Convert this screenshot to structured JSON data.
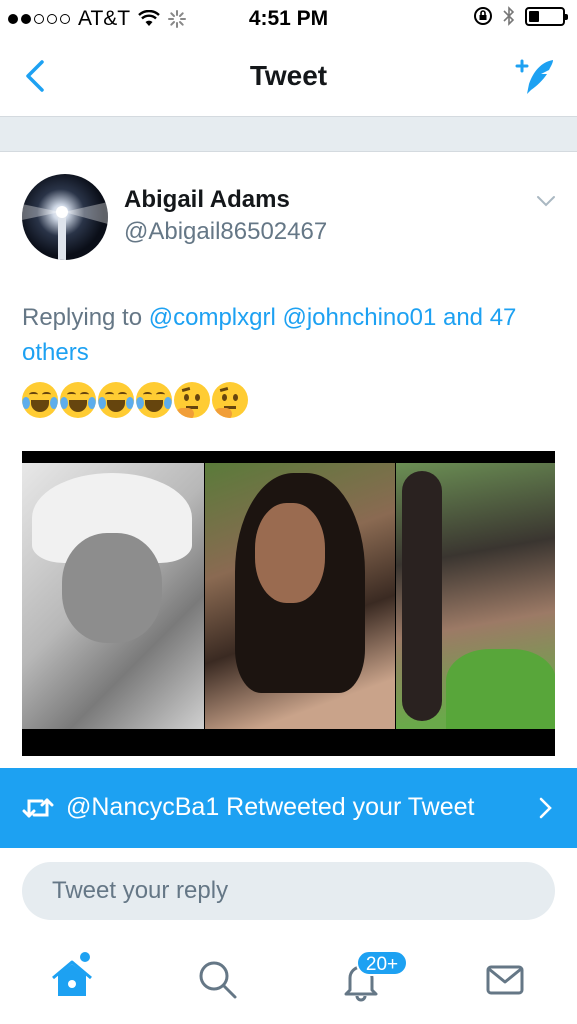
{
  "status_bar": {
    "carrier": "AT&T",
    "time": "4:51 PM",
    "signal_bars_filled": 2,
    "signal_bars_total": 5,
    "battery_level": 0.3
  },
  "nav": {
    "title": "Tweet",
    "back_icon": "chevron-left-icon",
    "compose_icon": "compose-tweet-icon"
  },
  "tweet": {
    "author_name": "Abigail Adams",
    "author_handle": "@Abigail86502467",
    "replying_prefix": "Replying to",
    "replying_mentions": [
      "@complxgrl",
      "@johnchino01"
    ],
    "replying_and": "and",
    "replying_others": "47 others",
    "emojis": [
      "face-with-tears-of-joy",
      "face-with-tears-of-joy",
      "face-with-tears-of-joy",
      "face-with-tears-of-joy",
      "thinking-face",
      "thinking-face"
    ]
  },
  "retweet_banner": {
    "text": "@NancycBa1 Retweeted your Tweet"
  },
  "reply": {
    "placeholder": "Tweet your reply"
  },
  "tabs": {
    "notifications_badge": "20+"
  },
  "colors": {
    "accent": "#1da1f2",
    "secondary_text": "#657786",
    "band": "#e6ecf0"
  }
}
